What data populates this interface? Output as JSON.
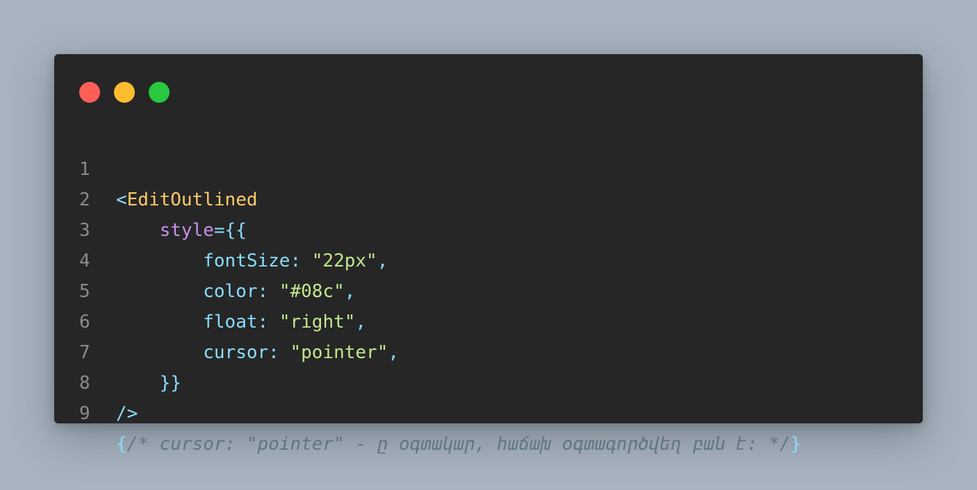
{
  "window": {
    "controls": [
      "close",
      "minimize",
      "maximize"
    ]
  },
  "colors": {
    "background": "#a8b3bf",
    "window": "#262626",
    "close": "#ff5f57",
    "minimize": "#febc2e",
    "maximize": "#28c840",
    "line_number": "#8b8b8b",
    "tag": "#ffcb6b",
    "punctuation": "#89ddff",
    "attribute": "#c792ea",
    "string": "#c3e88d",
    "comment": "#5f7682"
  },
  "code": {
    "lines": [
      {
        "num": "1",
        "open": "<",
        "tag": "EditOutlined"
      },
      {
        "num": "2",
        "indent": "    ",
        "attr": "style",
        "eq": "={{"
      },
      {
        "num": "3",
        "indent": "        ",
        "prop": "fontSize",
        "colon": ": ",
        "value": "\"22px\"",
        "comma": ","
      },
      {
        "num": "4",
        "indent": "        ",
        "prop": "color",
        "colon": ": ",
        "value": "\"#08c\"",
        "comma": ","
      },
      {
        "num": "5",
        "indent": "        ",
        "prop": "float",
        "colon": ": ",
        "value": "\"right\"",
        "comma": ","
      },
      {
        "num": "6",
        "indent": "        ",
        "prop": "cursor",
        "colon": ": ",
        "value": "\"pointer\"",
        "comma": ","
      },
      {
        "num": "7",
        "indent": "    ",
        "close": "}}"
      },
      {
        "num": "8",
        "close": "/>"
      },
      {
        "num": "9",
        "open": "{",
        "comment": "/* cursor: \"pointer\" - ը օգտակար, հաճախ օգտագործվեղ բան է: */",
        "close": "}"
      }
    ]
  }
}
